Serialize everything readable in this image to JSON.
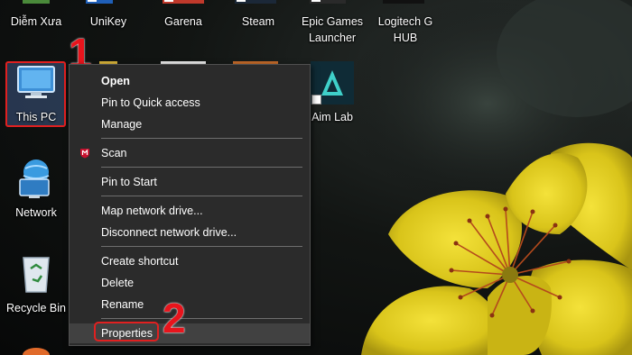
{
  "desktop": {
    "top_icons": [
      {
        "label": "Diễm Xưa"
      },
      {
        "label": "UniKey"
      },
      {
        "label": "Garena"
      },
      {
        "label": "Steam"
      },
      {
        "label": "Epic Games Launcher",
        "line1": "Epic Games",
        "line2": "Launcher"
      },
      {
        "label": "Logitech G HUB",
        "line1": "Logitech G",
        "line2": "HUB"
      }
    ],
    "left_icons": [
      {
        "label": "This PC",
        "icon": "computer-icon"
      },
      {
        "label": "Network",
        "icon": "network-icon"
      },
      {
        "label": "Recycle Bin",
        "icon": "recycle-bin-icon"
      }
    ],
    "aim_lab": {
      "label": "Aim Lab"
    }
  },
  "context_menu": {
    "open": "Open",
    "pin_quick_access": "Pin to Quick access",
    "manage": "Manage",
    "scan": "Scan",
    "pin_start": "Pin to Start",
    "map_drive": "Map network drive...",
    "disconnect_drive": "Disconnect network drive...",
    "create_shortcut": "Create shortcut",
    "delete": "Delete",
    "rename": "Rename",
    "properties": "Properties"
  },
  "annotations": {
    "step1": "1",
    "step2": "2"
  },
  "colors": {
    "menu_bg": "#2b2b2b",
    "highlight_red": "#e02020",
    "flower_yellow": "#e6d21a"
  }
}
